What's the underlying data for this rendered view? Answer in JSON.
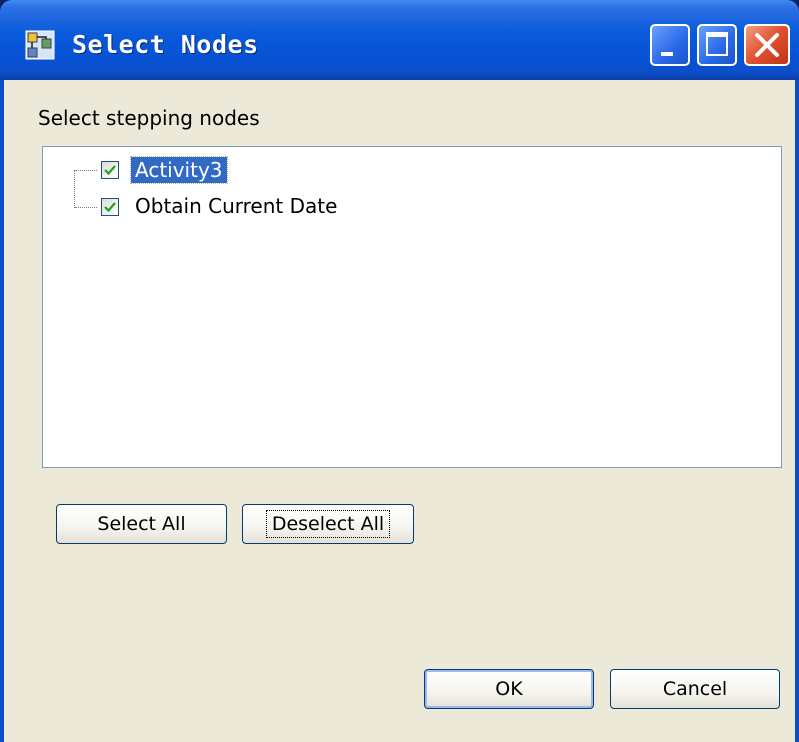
{
  "window": {
    "title": "Select Nodes",
    "app_icon": "tree-nodes-icon"
  },
  "titlebar_buttons": {
    "minimize": "minimize-icon",
    "maximize": "maximize-icon",
    "close": "close-icon"
  },
  "dialog": {
    "prompt": "Select stepping nodes"
  },
  "tree": {
    "nodes": [
      {
        "label": "Activity3",
        "checked": true,
        "selected": true
      },
      {
        "label": "Obtain Current Date",
        "checked": true,
        "selected": false
      }
    ]
  },
  "buttons": {
    "select_all": "Select All",
    "deselect_all": "Deselect All",
    "ok": "OK",
    "cancel": "Cancel"
  },
  "colors": {
    "titlebar": "#0A5BDB",
    "client_background": "#ECE9D8",
    "selection": "#316AC5",
    "close_button": "#E05030"
  }
}
